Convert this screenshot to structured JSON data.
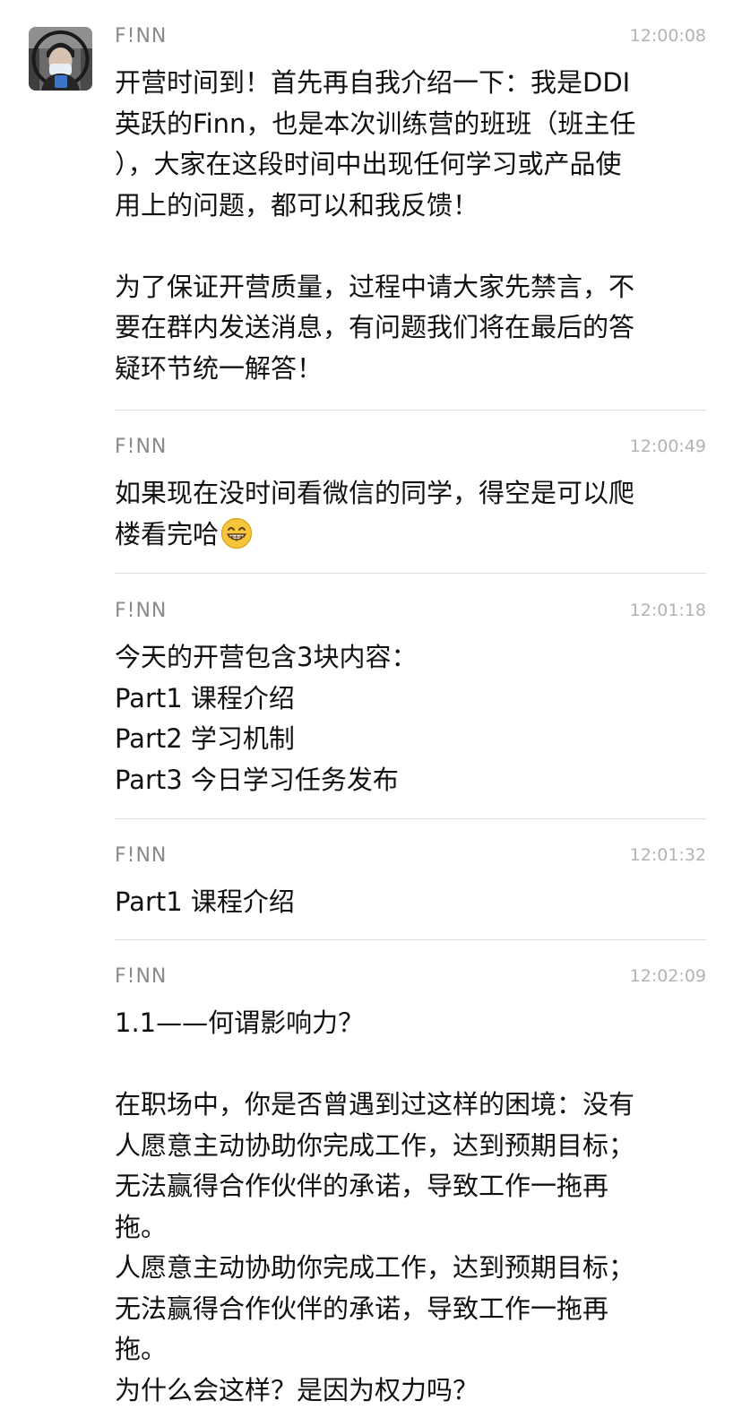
{
  "messages": [
    {
      "sender": "F!NN",
      "time": "12:00:08",
      "lines": [
        "开营时间到！首先再自我介绍一下：我是DDI",
        "英跃的Finn，也是本次训练营的班班（班主任",
        "），大家在这段时间中出现任何学习或产品使",
        "用上的问题，都可以和我反馈！",
        "",
        "为了保证开营质量，过程中请大家先禁言，不",
        "要在群内发送消息，有问题我们将在最后的答",
        "疑环节统一解答！"
      ]
    },
    {
      "sender": "F!NN",
      "time": "12:00:49",
      "lines": [
        "如果现在没时间看微信的同学，得空是可以爬",
        "楼看完哈"
      ],
      "emoji": "grinning-face-emoji"
    },
    {
      "sender": "F!NN",
      "time": "12:01:18",
      "lines": [
        "今天的开营包含3块内容：",
        "Part1  课程介绍",
        "Part2  学习机制",
        "Part3  今日学习任务发布"
      ]
    },
    {
      "sender": "F!NN",
      "time": "12:01:32",
      "lines": [
        "Part1  课程介绍"
      ]
    },
    {
      "sender": "F!NN",
      "time": "12:02:09",
      "lines": [
        "1.1——何谓影响力？",
        "",
        "在职场中，你是否曾遇到过这样的困境：没有",
        "人愿意主动协助你完成工作，达到预期目标；",
        "无法赢得合作伙伴的承诺，导致工作一拖再",
        "拖。",
        "人愿意主动协助你完成工作，达到预期目标；",
        "无法赢得合作伙伴的承诺，导致工作一拖再",
        "拖。",
        "为什么会这样？是因为权力吗？"
      ]
    }
  ]
}
